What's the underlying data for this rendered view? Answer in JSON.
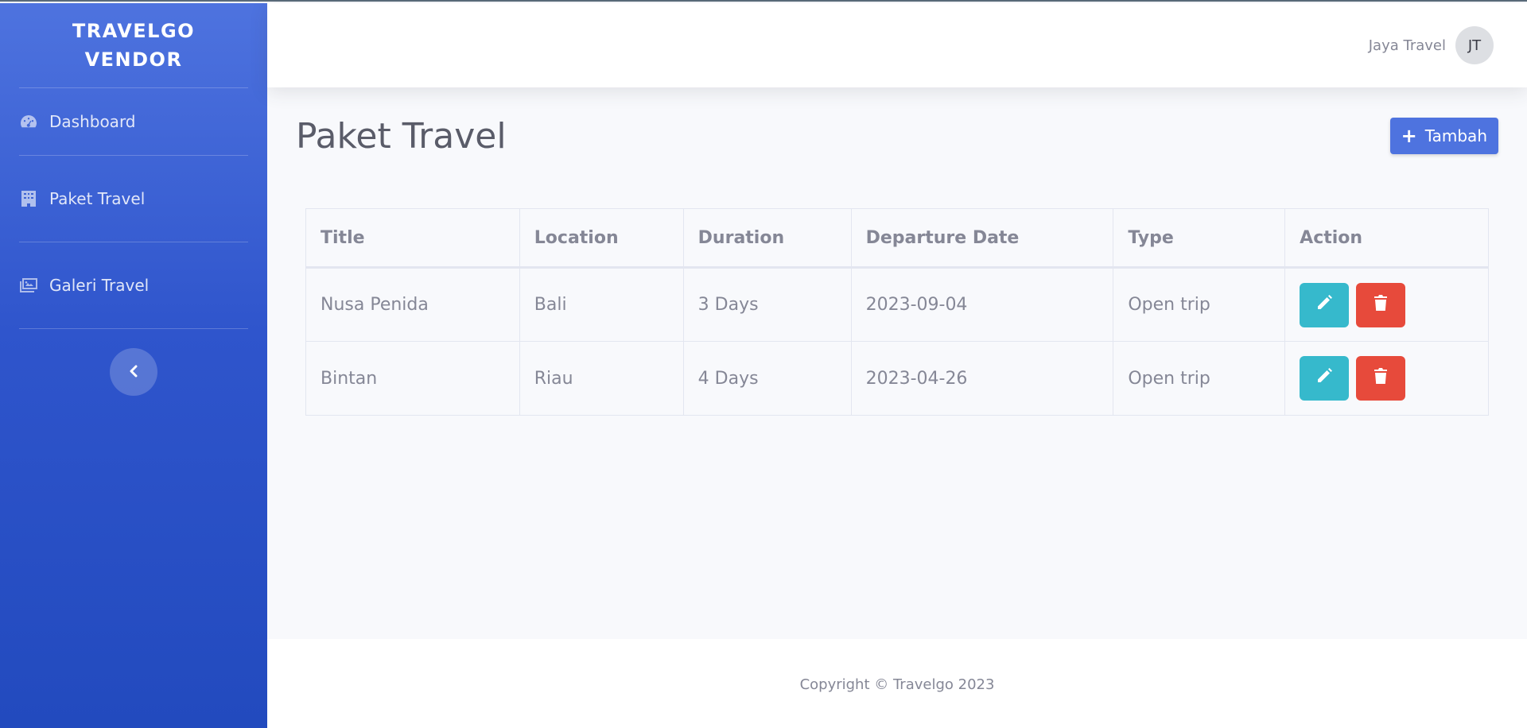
{
  "sidebar": {
    "brand_line1": "TRAVELGO",
    "brand_line2": "VENDOR",
    "items": [
      {
        "label": "Dashboard",
        "icon": "tachometer-icon"
      },
      {
        "label": "Paket Travel",
        "icon": "building-icon"
      },
      {
        "label": "Galeri Travel",
        "icon": "images-icon"
      }
    ],
    "toggle_icon": "chevron-left-icon"
  },
  "topbar": {
    "user_name": "Jaya Travel",
    "avatar_initials": "JT"
  },
  "main": {
    "title": "Paket Travel",
    "add_button_label": "Tambah",
    "table": {
      "headers": [
        "Title",
        "Location",
        "Duration",
        "Departure Date",
        "Type",
        "Action"
      ],
      "rows": [
        [
          "Nusa Penida",
          "Bali",
          "3 Days",
          "2023-09-04",
          "Open trip"
        ],
        [
          "Bintan",
          "Riau",
          "4 Days",
          "2023-04-26",
          "Open trip"
        ]
      ]
    }
  },
  "footer": {
    "text": "Copyright © Travelgo 2023"
  },
  "colors": {
    "primary": "#4e73df",
    "info": "#36b9cc",
    "danger": "#e74a3b",
    "text_muted": "#858796"
  }
}
